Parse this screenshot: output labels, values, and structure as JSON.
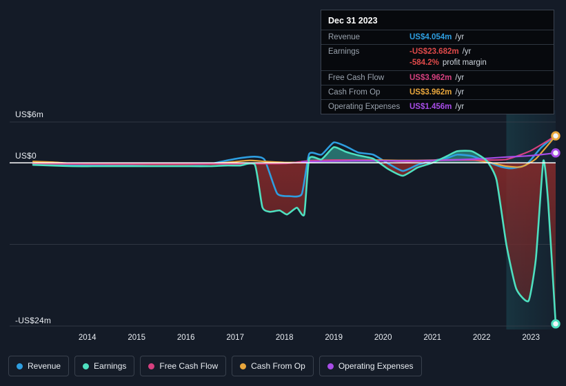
{
  "tooltip": {
    "title": "Dec 31 2023",
    "rows": [
      {
        "key": "Revenue",
        "value": "US$4.054m",
        "unit": "/yr",
        "color": "#2e9ee0"
      },
      {
        "key": "Earnings",
        "value": "-US$23.682m",
        "unit": "/yr",
        "color": "#e04a4a"
      },
      {
        "key": "",
        "value": "-584.2%",
        "unit": "profit margin",
        "color": "#e04a4a"
      },
      {
        "key": "Free Cash Flow",
        "value": "US$3.962m",
        "unit": "/yr",
        "color": "#d6407f"
      },
      {
        "key": "Cash From Op",
        "value": "US$3.962m",
        "unit": "/yr",
        "color": "#e8a63c"
      },
      {
        "key": "Operating Expenses",
        "value": "US$1.456m",
        "unit": "/yr",
        "color": "#a84de8"
      }
    ]
  },
  "legend": [
    {
      "label": "Revenue",
      "color": "#2e9ee0"
    },
    {
      "label": "Earnings",
      "color": "#4ee0c0"
    },
    {
      "label": "Free Cash Flow",
      "color": "#d6407f"
    },
    {
      "label": "Cash From Op",
      "color": "#e8a63c"
    },
    {
      "label": "Operating Expenses",
      "color": "#a84de8"
    }
  ],
  "axis": {
    "y_top_label": "US$6m",
    "y_zero_label": "US$0",
    "y_bottom_label": "-US$24m"
  },
  "chart_data": {
    "type": "line",
    "title": "",
    "xlabel": "",
    "ylabel": "",
    "ylim": [
      -24,
      6
    ],
    "grid": true,
    "legend_position": "bottom",
    "y_ticks": [
      6,
      0,
      -12,
      -24
    ],
    "y_tick_labels": [
      "US$6m",
      "US$0",
      "",
      "-US$24m"
    ],
    "x_tick_labels": [
      "2014",
      "2015",
      "2016",
      "2017",
      "2018",
      "2019",
      "2020",
      "2021",
      "2022",
      "2023"
    ],
    "x_range": [
      2013.4,
      2024.0
    ],
    "forecast_band_start": 2023.0,
    "currency": "USD",
    "units": "millions",
    "series": [
      {
        "name": "Revenue",
        "color": "#2e9ee0",
        "x": [
          2013.4,
          2013.8,
          2014.2,
          2014.6,
          2015.0,
          2015.4,
          2015.8,
          2016.2,
          2016.6,
          2017.0,
          2017.3,
          2017.6,
          2017.9,
          2018.1,
          2018.35,
          2018.6,
          2018.85,
          2019.0,
          2019.25,
          2019.5,
          2019.75,
          2020.0,
          2020.3,
          2020.6,
          2020.9,
          2021.2,
          2021.5,
          2021.8,
          2022.0,
          2022.3,
          2022.6,
          2022.9,
          2023.1,
          2023.4,
          2023.7,
          2024.0
        ],
        "y": [
          -0.1,
          -0.2,
          -0.3,
          -0.3,
          -0.3,
          -0.25,
          -0.2,
          -0.2,
          -0.2,
          -0.15,
          0.3,
          0.7,
          0.9,
          0.4,
          -4.5,
          -4.9,
          -4.6,
          1.3,
          1.2,
          3.0,
          2.4,
          1.5,
          1.2,
          -0.1,
          -1.2,
          -0.3,
          0.3,
          0.7,
          1.2,
          1.0,
          0.2,
          -0.6,
          -0.8,
          -0.3,
          2.2,
          4.054
        ]
      },
      {
        "name": "Earnings",
        "color": "#4ee0c0",
        "x": [
          2013.4,
          2013.8,
          2014.2,
          2014.6,
          2015.0,
          2015.4,
          2015.8,
          2016.2,
          2016.6,
          2017.0,
          2017.3,
          2017.6,
          2017.9,
          2018.05,
          2018.2,
          2018.4,
          2018.55,
          2018.75,
          2018.9,
          2019.0,
          2019.25,
          2019.5,
          2019.75,
          2020.0,
          2020.3,
          2020.6,
          2020.9,
          2021.2,
          2021.5,
          2021.8,
          2022.0,
          2022.3,
          2022.6,
          2022.8,
          2023.0,
          2023.2,
          2023.45,
          2023.6,
          2023.75,
          2023.85,
          2024.0
        ],
        "y": [
          -0.3,
          -0.4,
          -0.5,
          -0.5,
          -0.5,
          -0.5,
          -0.5,
          -0.5,
          -0.5,
          -0.5,
          -0.4,
          -0.4,
          -0.3,
          -6.5,
          -7.2,
          -7.0,
          -7.6,
          -6.6,
          -7.6,
          0.6,
          0.5,
          2.3,
          1.6,
          1.1,
          0.6,
          -0.9,
          -1.9,
          -0.7,
          0.0,
          1.0,
          1.7,
          1.7,
          0.3,
          -2.5,
          -12.0,
          -18.5,
          -20.3,
          -14.0,
          0.3,
          -6.0,
          -23.682
        ]
      },
      {
        "name": "Free Cash Flow",
        "color": "#d6407f",
        "x": [
          2013.4,
          2014.5,
          2015.5,
          2016.5,
          2017.5,
          2018.5,
          2019.0,
          2019.5,
          2020.0,
          2020.5,
          2021.0,
          2021.5,
          2022.0,
          2022.5,
          2023.0,
          2023.5,
          2024.0
        ],
        "y": [
          -0.1,
          -0.2,
          -0.2,
          -0.2,
          -0.15,
          -0.1,
          0.3,
          0.4,
          0.4,
          0.3,
          0.2,
          0.3,
          0.4,
          0.4,
          0.5,
          1.8,
          3.962
        ]
      },
      {
        "name": "Cash From Op",
        "color": "#e8a63c",
        "x": [
          2013.4,
          2013.8,
          2014.2,
          2014.6,
          2015.0,
          2015.5,
          2016.0,
          2016.5,
          2017.0,
          2017.4,
          2017.8,
          2018.1,
          2018.5,
          2018.9,
          2019.2,
          2019.6,
          2020.0,
          2020.4,
          2020.8,
          2021.2,
          2021.6,
          2022.0,
          2022.4,
          2022.7,
          2023.0,
          2023.3,
          2023.6,
          2024.0
        ],
        "y": [
          0.2,
          0.1,
          -0.1,
          -0.15,
          -0.2,
          -0.2,
          -0.2,
          -0.2,
          -0.1,
          0.1,
          0.35,
          0.2,
          0.05,
          0.1,
          0.35,
          0.4,
          0.4,
          0.4,
          0.35,
          0.35,
          0.4,
          0.45,
          0.35,
          0.0,
          -0.5,
          -0.6,
          0.6,
          3.962
        ]
      },
      {
        "name": "Operating Expenses",
        "color": "#a84de8",
        "x": [
          2018.85,
          2019.1,
          2019.5,
          2020.0,
          2020.5,
          2021.0,
          2021.5,
          2022.0,
          2022.5,
          2023.0,
          2023.4,
          2023.7,
          2024.0
        ],
        "y": [
          0.15,
          0.2,
          0.25,
          0.3,
          0.3,
          0.3,
          0.35,
          0.45,
          0.6,
          0.85,
          1.0,
          1.2,
          1.456
        ]
      }
    ],
    "end_markers": [
      {
        "name": "Cash From Op",
        "value": 3.962,
        "color": "#e8a63c"
      },
      {
        "name": "Operating Expenses",
        "value": 1.456,
        "color": "#a84de8"
      },
      {
        "name": "Earnings",
        "value": -23.682,
        "color": "#4ee0c0"
      }
    ]
  }
}
